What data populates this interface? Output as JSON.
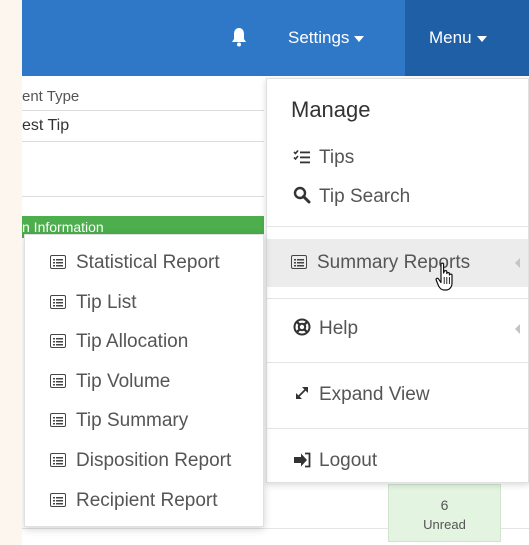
{
  "navbar": {
    "bell_icon": "bell-icon",
    "settings_label": "Settings",
    "menu_label": "Menu",
    "colors": {
      "bar": "#2f78c8",
      "active": "#1e5fa6"
    }
  },
  "form": {
    "field_label": "ent Type",
    "field_value": "est Tip",
    "section_title": "n Information"
  },
  "unread": {
    "count": "6",
    "label": "Unread"
  },
  "main_menu": {
    "heading": "Manage",
    "tips": "Tips",
    "tip_search": "Tip Search",
    "summary_reports": "Summary Reports",
    "help": "Help",
    "expand_view": "Expand View",
    "logout": "Logout"
  },
  "submenu": {
    "items": [
      "Statistical Report",
      "Tip List",
      "Tip Allocation",
      "Tip Volume",
      "Tip Summary",
      "Disposition Report",
      "Recipient Report"
    ]
  }
}
